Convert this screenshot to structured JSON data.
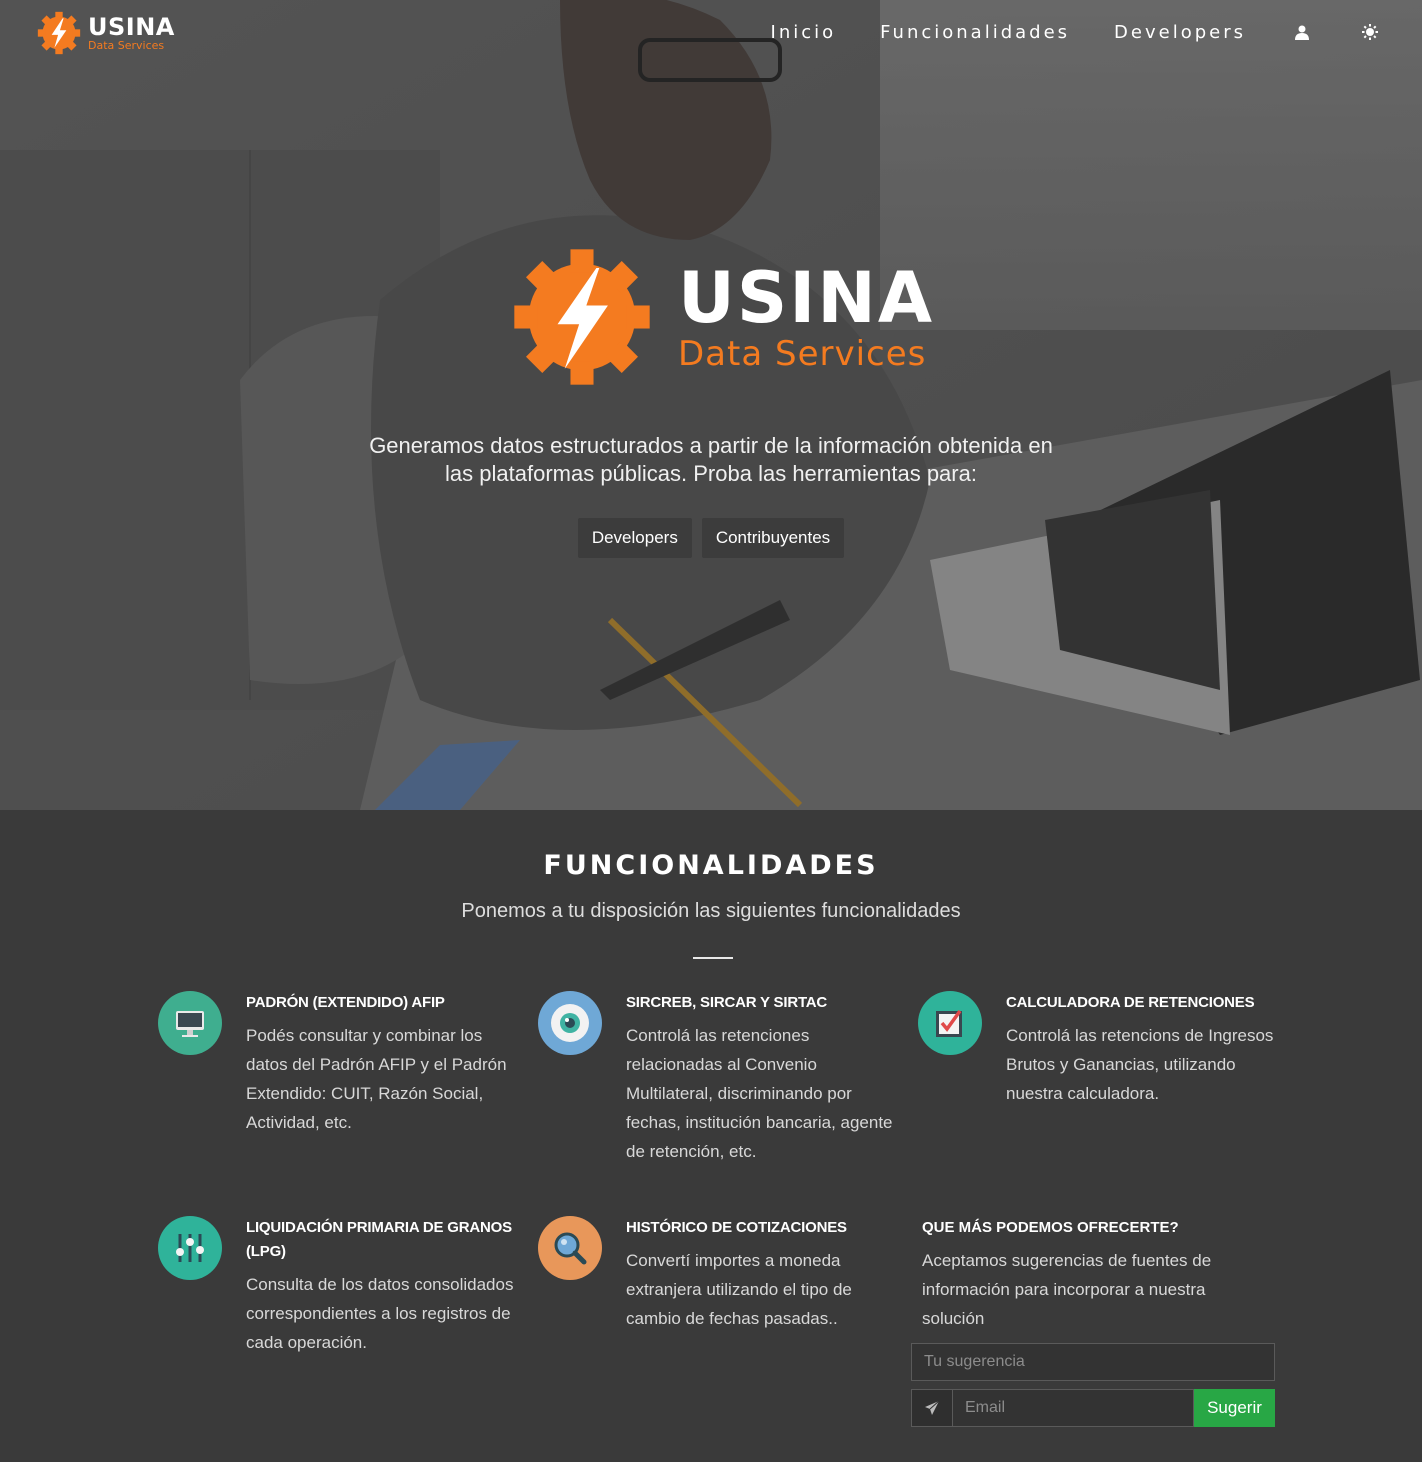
{
  "brand": {
    "title": "USINA",
    "subtitle": "Data Services"
  },
  "nav": {
    "links": [
      "Inicio",
      "Funcionalidades",
      "Developers"
    ],
    "user_icon": "user-icon",
    "theme_icon": "sun-icon"
  },
  "hero": {
    "logo_title": "USINA",
    "logo_subtitle": "Data Services",
    "tagline_line1": "Generamos datos estructurados a partir de la información obtenida en",
    "tagline_line2": "las plataformas públicas. Proba las herramientas para:",
    "buttons": [
      "Developers",
      "Contribuyentes"
    ]
  },
  "features_section": {
    "title": "FUNCIONALIDADES",
    "subtitle": "Ponemos a tu disposición las siguientes funcionalidades",
    "items": [
      {
        "heading": "PADRÓN (EXTENDIDO) AFIP",
        "text": "Podés consultar y combinar los datos del Padrón AFIP y el Padrón Extendido: CUIT, Razón Social, Actividad, etc.",
        "icon": "monitor-icon",
        "icon_color": "#3fae8f"
      },
      {
        "heading": "SIRCREB, SIRCAR Y SIRTAC",
        "text": "Controlá las retenciones relacionadas al Convenio Multilateral, discriminando por fechas, institución bancaria, agente de retención, etc.",
        "icon": "eye-icon",
        "icon_color": "#6fa8d6"
      },
      {
        "heading": "CALCULADORA DE RETENCIONES",
        "text": "Controlá las retencions de Ingresos Brutos y Ganancias, utilizando nuestra calculadora.",
        "icon": "checkbox-icon",
        "icon_color": "#2fb39a"
      },
      {
        "heading": "LIQUIDACIÓN PRIMARIA DE GRANOS (LPG)",
        "text": "Consulta de los datos consolidados correspondientes a los registros de cada operación.",
        "icon": "sliders-icon",
        "icon_color": "#2fb39a"
      },
      {
        "heading": "HISTÓRICO DE COTIZACIONES",
        "text": "Convertí importes a moneda extranjera utilizando el tipo de cambio de fechas pasadas..",
        "icon": "magnifier-icon",
        "icon_color": "#e8975a"
      }
    ]
  },
  "offer": {
    "heading": "QUE MÁS PODEMOS OFRECERTE?",
    "text": "Aceptamos sugerencias de fuentes de información para incorporar a nuestra solución",
    "suggestion_placeholder": "Tu sugerencia",
    "email_placeholder": "Email",
    "submit_label": "Sugerir",
    "send_icon": "paper-plane-icon"
  },
  "colors": {
    "accent": "#f47b20",
    "success": "#28a745",
    "section_bg": "#3a3a3a"
  }
}
